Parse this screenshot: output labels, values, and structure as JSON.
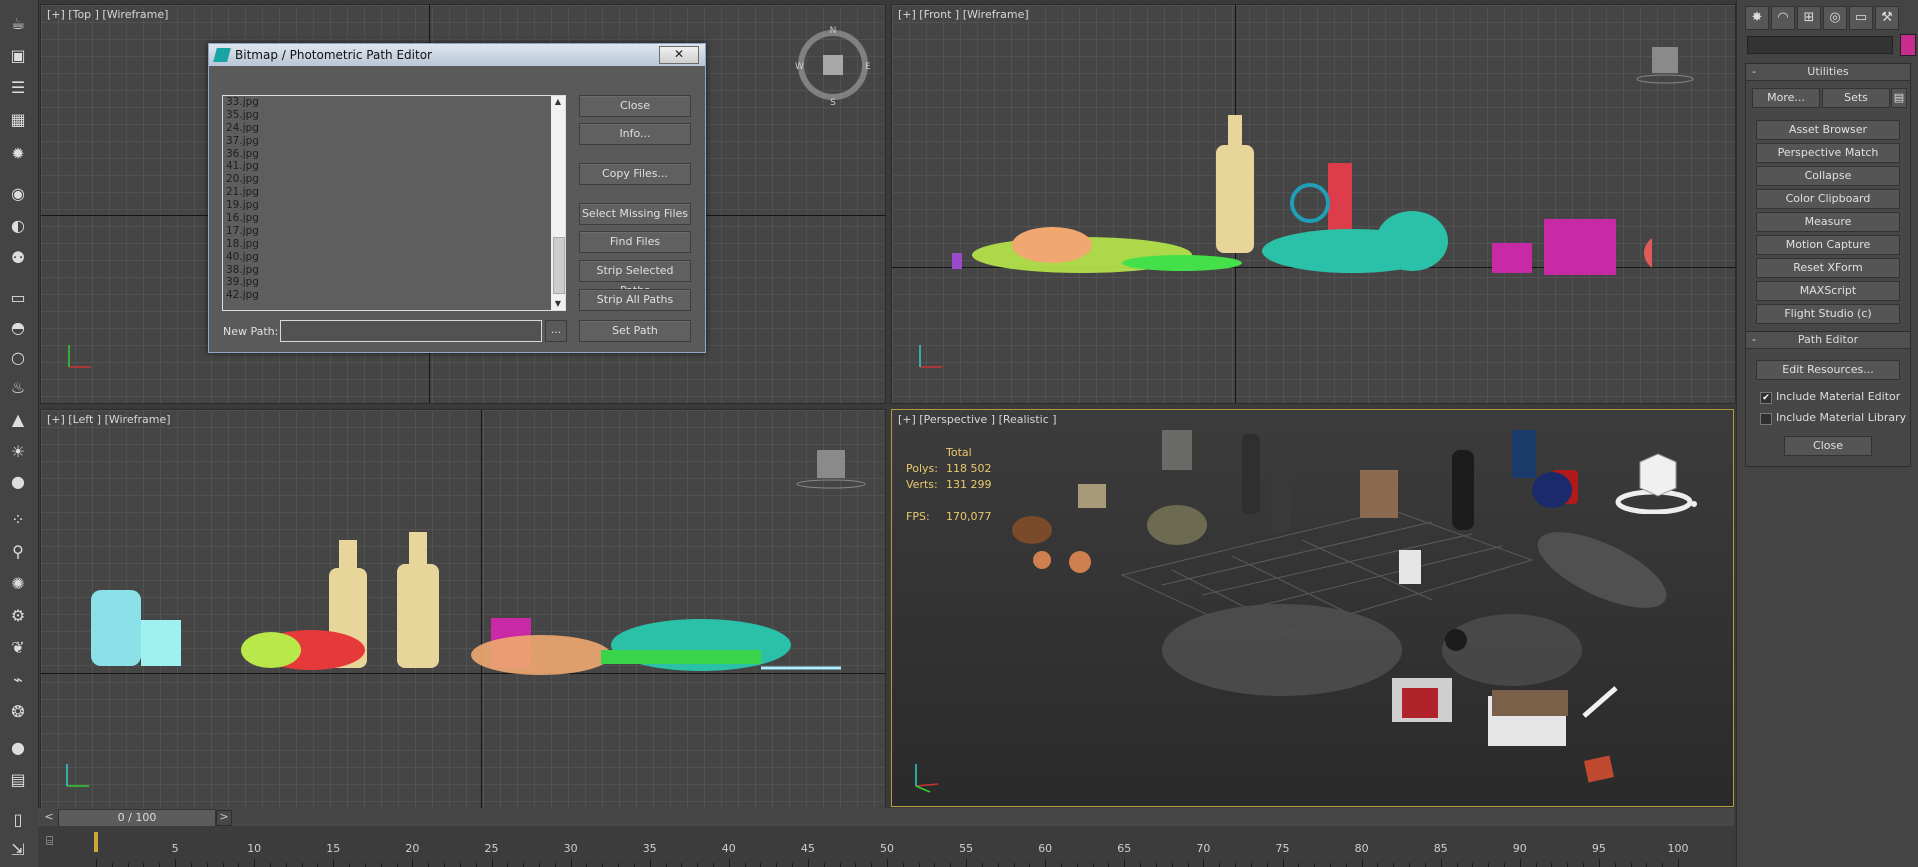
{
  "viewports": {
    "top": {
      "label": "[+] [Top ] [Wireframe]"
    },
    "front": {
      "label": "[+] [Front ] [Wireframe]"
    },
    "left": {
      "label": "[+] [Left ] [Wireframe]"
    },
    "perspective": {
      "label": "[+] [Perspective ] [Realistic ]"
    }
  },
  "stats": {
    "total_label": "Total",
    "polys_label": "Polys:",
    "polys_value": "118 502",
    "verts_label": "Verts:",
    "verts_value": "131 299",
    "fps_label": "FPS:",
    "fps_value": "170,077"
  },
  "dialog": {
    "title": "Bitmap / Photometric Path Editor",
    "close_x": "✕",
    "files": [
      "33.jpg",
      "35.jpg",
      "24.jpg",
      "37.jpg",
      "36.jpg",
      "41.jpg",
      "20.jpg",
      "21.jpg",
      "19.jpg",
      "16.jpg",
      "17.jpg",
      "18.jpg",
      "40.jpg",
      "38.jpg",
      "39.jpg",
      "42.jpg"
    ],
    "buttons": {
      "close": "Close",
      "info": "Info...",
      "copy": "Copy Files...",
      "select_missing": "Select Missing Files",
      "find": "Find Files",
      "strip_selected": "Strip Selected Paths",
      "strip_all": "Strip All Paths",
      "set_path": "Set Path"
    },
    "new_path_label": "New Path:",
    "new_path_value": "",
    "browse": "..."
  },
  "command_panel": {
    "tabs": [
      "create-icon",
      "modify-icon",
      "hierarchy-icon",
      "motion-icon",
      "display-icon",
      "utilities-icon"
    ],
    "utilities": {
      "title": "Utilities",
      "more": "More...",
      "sets": "Sets",
      "items": [
        "Asset Browser",
        "Perspective Match",
        "Collapse",
        "Color Clipboard",
        "Measure",
        "Motion Capture",
        "Reset XForm",
        "MAXScript",
        "Flight Studio (c)"
      ]
    },
    "path_editor": {
      "title": "Path Editor",
      "edit_resources": "Edit Resources...",
      "include_material_editor": "Include Material Editor",
      "include_material_editor_checked": true,
      "include_material_library": "Include Material Library",
      "include_material_library_checked": false,
      "close": "Close"
    }
  },
  "timeline": {
    "slider_text": "0 / 100",
    "prev": "<",
    "next": ">",
    "ticks": [
      "5",
      "10",
      "15",
      "20",
      "25",
      "30",
      "35",
      "40",
      "45",
      "50",
      "55",
      "60",
      "65",
      "70",
      "75",
      "80",
      "85",
      "90",
      "95",
      "100"
    ]
  },
  "colors": {
    "accent": "#b49a3d",
    "stats": "#e8c96a"
  }
}
